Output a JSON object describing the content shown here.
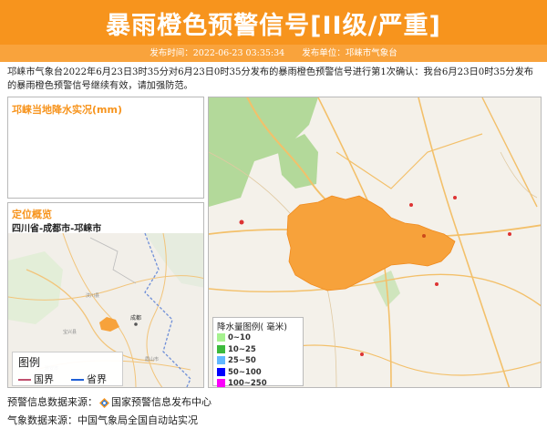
{
  "header": {
    "title": "暴雨橙色预警信号[II级/严重]",
    "publish_time": "发布时间：2022-06-23 03:35:34",
    "publisher": "发布单位：邛崃市气象台"
  },
  "description": "邛崃市气象台2022年6月23日3时35分对6月23日0时35分发布的暴雨橙色预警信号进行第1次确认：我台6月23日0时35分发布的暴雨橙色预警信号继续有效，请加强防范。",
  "rain_panel": {
    "title": "邛崃当地降水实况(mm)"
  },
  "location_panel": {
    "title": "定位概览",
    "location": "四川省-成都市-邛崃市",
    "legend": {
      "title": "图例",
      "items": [
        {
          "label": "国界",
          "color": "#c0506e"
        },
        {
          "label": "省界",
          "color": "#1f5fd6"
        }
      ]
    }
  },
  "main_map": {
    "legend": {
      "title": "降水量图例( 毫米)",
      "items": [
        {
          "label": "0~10",
          "color": "#a6f28f"
        },
        {
          "label": "10~25",
          "color": "#3dba3d"
        },
        {
          "label": "25~50",
          "color": "#61b8ff"
        },
        {
          "label": "50~100",
          "color": "#0000fe"
        },
        {
          "label": "100~250",
          "color": "#fa00fa"
        }
      ]
    },
    "warning_area_color": "#f7a23b"
  },
  "footer": {
    "source_label": "预警信息数据来源：",
    "source_name": "国家预警信息发布中心",
    "weather_label": "气象数据来源：中国气象局全国自动站实况"
  }
}
